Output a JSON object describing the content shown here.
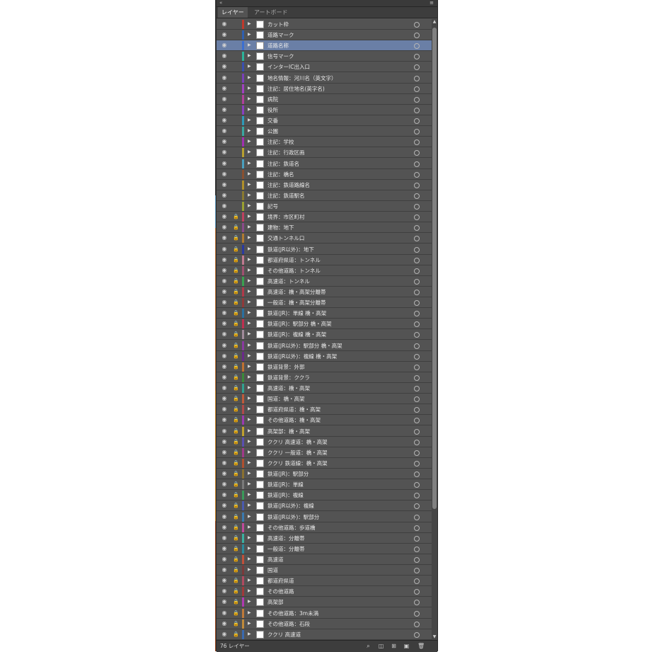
{
  "panel": {
    "collapse_glyph": "«",
    "menu_glyph": "≡",
    "tabs": [
      {
        "label": "レイヤー",
        "active": true
      },
      {
        "label": "アートボード",
        "active": false
      }
    ],
    "layer_count_label": "76 レイヤー",
    "icons": {
      "eye": "👁",
      "lock": "🔒",
      "expand": "▶",
      "target": "circle"
    },
    "selected_color": "#6a7fa6"
  },
  "layers": [
    {
      "name": "カット枠",
      "color": "#c0392b",
      "locked": false
    },
    {
      "name": "道路マーク",
      "color": "#2e5fb0",
      "locked": false
    },
    {
      "name": "道路名称",
      "color": "#3b6fd1",
      "locked": false,
      "selected": true
    },
    {
      "name": "信号マーク",
      "color": "#2bb39a",
      "locked": false
    },
    {
      "name": "インターIC出入口",
      "color": "#3a4fb0",
      "locked": false
    },
    {
      "name": "地名情報：河川名（英文字）",
      "color": "#7a3fb8",
      "locked": false
    },
    {
      "name": "注記：居住地名(英字名)",
      "color": "#a040c0",
      "locked": false
    },
    {
      "name": "病院",
      "color": "#b0409a",
      "locked": false
    },
    {
      "name": "役所",
      "color": "#8a3fc0",
      "locked": false
    },
    {
      "name": "交番",
      "color": "#2e9ab8",
      "locked": false
    },
    {
      "name": "公園",
      "color": "#3aa7a0",
      "locked": false
    },
    {
      "name": "注記：学校",
      "color": "#a030b0",
      "locked": false
    },
    {
      "name": "注記：行政区画",
      "color": "#b8a030",
      "locked": false
    },
    {
      "name": "注記：鉄道名",
      "color": "#4aa0c0",
      "locked": false
    },
    {
      "name": "注記：橋名",
      "color": "#8a5030",
      "locked": false
    },
    {
      "name": "注記：鉄道路線名",
      "color": "#b0902a",
      "locked": false
    },
    {
      "name": "注記：鉄道駅名",
      "color": "#8a7a30",
      "locked": false
    },
    {
      "name": "記号",
      "color": "#9aa030",
      "locked": false
    },
    {
      "name": "境界：市区町村",
      "color": "#c04060",
      "locked": true
    },
    {
      "name": "建物：地下",
      "color": "#8a4a8a",
      "locked": true
    },
    {
      "name": "交通トンネル口",
      "color": "#b07a30",
      "locked": true
    },
    {
      "name": "鉄道(JR以外)：地下",
      "color": "#2a3aa0",
      "locked": true
    },
    {
      "name": "都道府県道：トンネル",
      "color": "#c07a90",
      "locked": true
    },
    {
      "name": "その他道路：トンネル",
      "color": "#a05070",
      "locked": true
    },
    {
      "name": "高速道：トンネル",
      "color": "#3aa050",
      "locked": true
    },
    {
      "name": "高速道：橋・高架分離帯",
      "color": "#b03a4a",
      "locked": true
    },
    {
      "name": "一般道：橋・高架分離帯",
      "color": "#903a3a",
      "locked": true
    },
    {
      "name": "鉄道(JR)：単線 橋・高架",
      "color": "#2a70a0",
      "locked": true
    },
    {
      "name": "鉄道(JR)：駅部分 橋・高架",
      "color": "#c03050",
      "locked": true
    },
    {
      "name": "鉄道(JR)：複線 橋・高架",
      "color": "#a08a9a",
      "locked": true
    },
    {
      "name": "鉄道(JR以外)：駅部分 橋・高架",
      "color": "#8a3aa0",
      "locked": true
    },
    {
      "name": "鉄道(JR以外)：複線 橋・高架",
      "color": "#6a2a8a",
      "locked": true
    },
    {
      "name": "鉄道背景：外郭",
      "color": "#c07030",
      "locked": true
    },
    {
      "name": "鉄道背景：ククラ",
      "color": "#3a8a3a",
      "locked": true
    },
    {
      "name": "高速道：橋・高架",
      "color": "#30a090",
      "locked": true
    },
    {
      "name": "国道：橋・高架",
      "color": "#c05a3a",
      "locked": true
    },
    {
      "name": "都道府県道：橋・高架",
      "color": "#b04a4a",
      "locked": true
    },
    {
      "name": "その他道路：橋・高架",
      "color": "#9a3ab0",
      "locked": true
    },
    {
      "name": "高架部：橋・高架",
      "color": "#c0a030",
      "locked": true
    },
    {
      "name": "ククリ 高速道：橋・高架",
      "color": "#5a50b0",
      "locked": true
    },
    {
      "name": "ククリ 一般道：橋・高架",
      "color": "#a03a8a",
      "locked": true
    },
    {
      "name": "ククリ 鉄道線：橋・高架",
      "color": "#b05030",
      "locked": true
    },
    {
      "name": "鉄道(JR)：駅部分",
      "color": "#8a7030",
      "locked": true
    },
    {
      "name": "鉄道(JR)：単線",
      "color": "#7a7a7a",
      "locked": true
    },
    {
      "name": "鉄道(JR)：複線",
      "color": "#3a9a5a",
      "locked": true
    },
    {
      "name": "鉄道(JR以外)：複線",
      "color": "#4a5ab0",
      "locked": true
    },
    {
      "name": "鉄道(JR以外)：駅部分",
      "color": "#3a7ab0",
      "locked": true
    },
    {
      "name": "その他道路：歩道橋",
      "color": "#c04a9a",
      "locked": true
    },
    {
      "name": "高速道：分離帯",
      "color": "#3ab0a0",
      "locked": true
    },
    {
      "name": "一般道：分離帯",
      "color": "#2a8a9a",
      "locked": true
    },
    {
      "name": "高速道",
      "color": "#c0503a",
      "locked": true
    },
    {
      "name": "国道",
      "color": "#7a3a3a",
      "locked": true
    },
    {
      "name": "都道府県道",
      "color": "#b04a60",
      "locked": true
    },
    {
      "name": "その他道路",
      "color": "#a03a3a",
      "locked": true
    },
    {
      "name": "高架部",
      "color": "#b03ab0",
      "locked": true
    },
    {
      "name": "その他道路：3m未満",
      "color": "#c07a3a",
      "locked": true
    },
    {
      "name": "その他道路：石段",
      "color": "#c08a3a",
      "locked": true
    },
    {
      "name": "ククリ 高速道",
      "color": "#3a6ab0",
      "locked": true
    }
  ]
}
